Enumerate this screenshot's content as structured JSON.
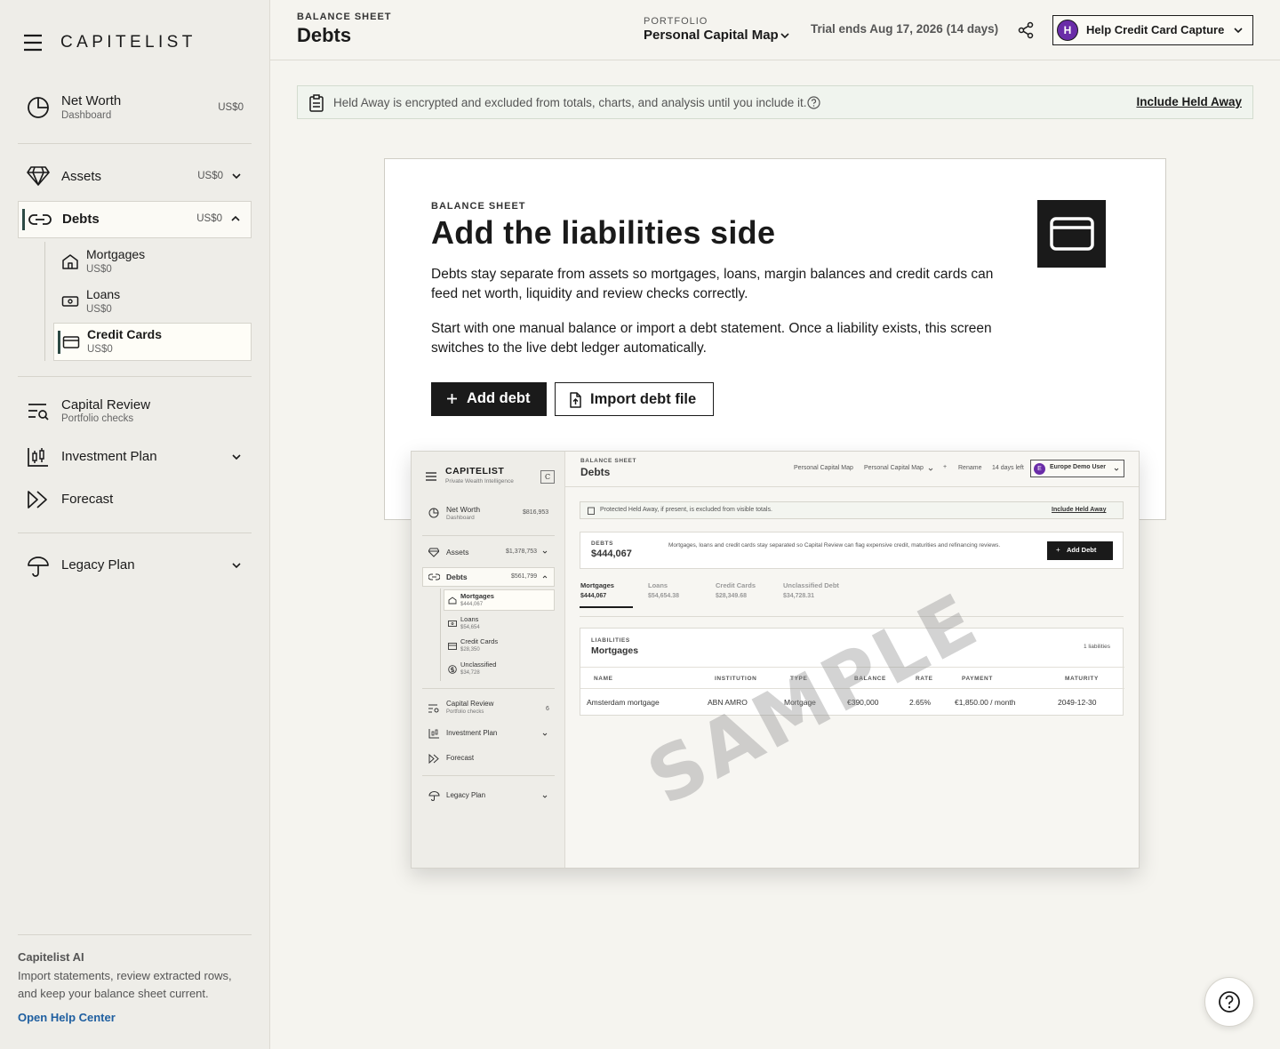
{
  "brand": "CAPITELIST",
  "sidebar": {
    "net_worth": {
      "label": "Net Worth",
      "sub": "Dashboard",
      "amount": "US$0"
    },
    "assets": {
      "label": "Assets",
      "amount": "US$0"
    },
    "debts": {
      "label": "Debts",
      "amount": "US$0"
    },
    "debt_items": [
      {
        "label": "Mortgages",
        "amount": "US$0"
      },
      {
        "label": "Loans",
        "amount": "US$0"
      },
      {
        "label": "Credit Cards",
        "amount": "US$0"
      }
    ],
    "capital_review": {
      "label": "Capital Review",
      "sub": "Portfolio checks"
    },
    "investment_plan": {
      "label": "Investment Plan"
    },
    "forecast": {
      "label": "Forecast"
    },
    "legacy_plan": {
      "label": "Legacy Plan"
    },
    "ai": {
      "title": "Capitelist AI",
      "description": "Import statements, review extracted rows, and keep your balance sheet current.",
      "link": "Open Help Center"
    }
  },
  "header": {
    "kicker": "BALANCE SHEET",
    "title": "Debts",
    "portfolio_label": "PORTFOLIO",
    "portfolio_name": "Personal Capital Map",
    "trial": "Trial ends Aug 17, 2026 (14 days)",
    "user_initial": "H",
    "user_name": "Help Credit Card Capture"
  },
  "notice": {
    "text": "Held Away is encrypted and excluded from totals, charts, and analysis until you include it.",
    "link": "Include Held Away"
  },
  "empty_state": {
    "kicker": "BALANCE SHEET",
    "title": "Add the liabilities side",
    "paragraph1": "Debts stay separate from assets so mortgages, loans, margin balances and credit cards can feed net worth, liquidity and review checks correctly.",
    "paragraph2": "Start with one manual balance or import a debt statement. Once a liability exists, this screen switches to the live debt ledger automatically.",
    "add_button": "Add debt",
    "import_button": "Import debt file"
  },
  "preview": {
    "watermark": "SAMPLE",
    "brand": "CAPITELIST",
    "tagline": "Private Wealth Intelligence",
    "brand_badge": "C",
    "nav": {
      "net_worth": "Net Worth",
      "net_worth_sub": "Dashboard",
      "net_worth_amt": "$816,953",
      "assets": "Assets",
      "assets_amt": "$1,378,753",
      "debts": "Debts",
      "debts_amt": "$561,799",
      "mortgages": "Mortgages",
      "mortgages_amt": "$444,067",
      "loans": "Loans",
      "loans_amt": "$54,654",
      "credit_cards": "Credit Cards",
      "credit_cards_amt": "$28,350",
      "unclassified": "Unclassified",
      "unclassified_amt": "$34,728",
      "capital_review": "Capital Review",
      "capital_review_sub": "Portfolio checks",
      "capital_review_count": "6",
      "investment_plan": "Investment Plan",
      "forecast": "Forecast",
      "legacy_plan": "Legacy Plan"
    },
    "header": {
      "kicker": "BALANCE SHEET",
      "title": "Debts",
      "portfolio_a": "Personal Capital Map",
      "portfolio_b": "Personal Capital Map",
      "plus": "+",
      "rename": "Rename",
      "days_left": "14 days left",
      "user_initial": "E",
      "user": "Europe Demo User"
    },
    "notice": "Protected Held Away, if present, is excluded from visible totals.",
    "notice_link": "Include Held Away",
    "summary": {
      "label": "DEBTS",
      "amount": "$444,067",
      "text": "Mortgages, loans and credit cards stay separated so Capital Review can flag expensive credit, maturities and refinancing reviews.",
      "button": "Add Debt"
    },
    "tabs": [
      {
        "label": "Mortgages",
        "amount": "$444,067"
      },
      {
        "label": "Loans",
        "amount": "$54,654.38"
      },
      {
        "label": "Credit Cards",
        "amount": "$28,349.68"
      },
      {
        "label": "Unclassified Debt",
        "amount": "$34,728.31"
      }
    ],
    "table": {
      "kicker": "LIABILITIES",
      "title": "Mortgages",
      "count": "1 liabilities",
      "headers": [
        "NAME",
        "INSTITUTION",
        "TYPE",
        "BALANCE",
        "RATE",
        "PAYMENT",
        "MATURITY"
      ],
      "row": [
        "Amsterdam mortgage",
        "ABN AMRO",
        "Mortgage",
        "€390,000",
        "2.65%",
        "€1,850.00 / month",
        "2049-12-30"
      ]
    }
  },
  "colors": {
    "accent": "#1a1a1a",
    "avatar": "#6a2da8",
    "link": "#1f5fa0",
    "active_bar": "#2c4a44"
  }
}
